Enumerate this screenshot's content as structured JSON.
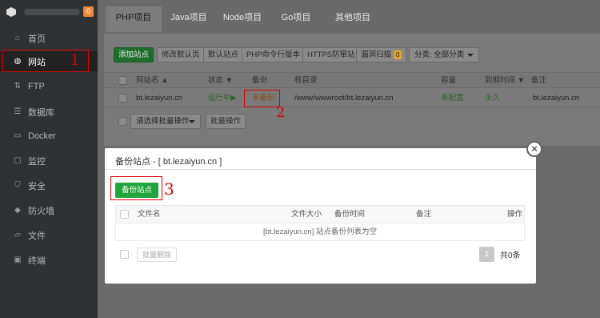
{
  "sidebar": {
    "badge": "0",
    "items": [
      {
        "label": "首页",
        "icon": "home-icon"
      },
      {
        "label": "网站",
        "icon": "globe-icon"
      },
      {
        "label": "FTP",
        "icon": "ftp-icon"
      },
      {
        "label": "数据库",
        "icon": "database-icon"
      },
      {
        "label": "Docker",
        "icon": "docker-icon"
      },
      {
        "label": "监控",
        "icon": "monitor-icon"
      },
      {
        "label": "安全",
        "icon": "shield-icon"
      },
      {
        "label": "防火墙",
        "icon": "firewall-icon"
      },
      {
        "label": "文件",
        "icon": "folder-icon"
      },
      {
        "label": "终端",
        "icon": "terminal-icon"
      }
    ]
  },
  "tabs": [
    "PHP项目",
    "Java项目",
    "Node项目",
    "Go项目",
    "其他项目"
  ],
  "toolbar": {
    "add_site": "添加站点",
    "default_page": "修改默认页",
    "default_site": "默认站点",
    "php_cli": "PHP命令行版本",
    "https_firewall": "HTTPS防窜站",
    "vuln_scan": "漏洞扫描",
    "vuln_count": "0",
    "category": "分类: 全部分类"
  },
  "site_table": {
    "headers": {
      "name": "网站名",
      "status": "状态",
      "backup": "备份",
      "root": "根目录",
      "capacity": "容量",
      "expire": "到期时间",
      "note": "备注"
    },
    "rows": [
      {
        "name": "bt.lezaiyun.cn",
        "status": "运行中▶",
        "backup": "未备份",
        "root": "/www/wwwroot/bt.lezaiyun.cn",
        "capacity": "未配置",
        "expire": "永久",
        "note": "bt.lezaiyun.cn"
      }
    ],
    "bulk_select": "请选择批量操作",
    "bulk_button": "批量操作"
  },
  "annotations": {
    "one": "1",
    "two": "2",
    "three": "3"
  },
  "modal": {
    "title": "备份站点 - [ bt.lezaiyun.cn ]",
    "close": "×",
    "backup_button": "备份站点",
    "headers": {
      "filename": "文件名",
      "size": "文件大小",
      "time": "备份时间",
      "note": "备注",
      "action": "操作"
    },
    "empty": "[bt.lezaiyun.cn] 站点备份列表为空",
    "bulk_delete": "批量删除",
    "page": "1",
    "total": "共0条"
  },
  "colors": {
    "sidebar_bg": "#2f3133",
    "accent_green": "#20a53a",
    "annotation_red": "#dd0000"
  }
}
